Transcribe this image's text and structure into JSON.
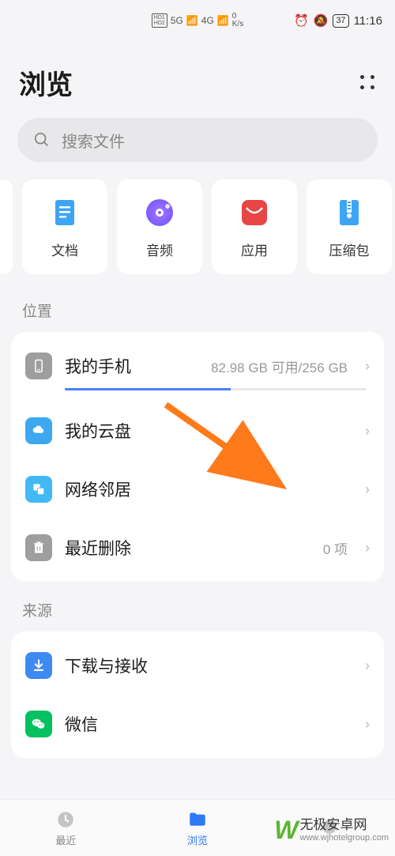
{
  "status": {
    "hd1": "HD1",
    "hd2": "HD2",
    "signal1": "5G",
    "signal2": "4G",
    "speed": "0",
    "speed_unit": "K/s",
    "battery": "37",
    "time": "11:16"
  },
  "header": {
    "title": "浏览"
  },
  "search": {
    "placeholder": "搜索文件"
  },
  "categories": [
    {
      "label": "文档",
      "icon": "document"
    },
    {
      "label": "音频",
      "icon": "audio"
    },
    {
      "label": "应用",
      "icon": "app"
    },
    {
      "label": "压缩包",
      "icon": "archive"
    }
  ],
  "sections": {
    "location": {
      "title": "位置",
      "items": [
        {
          "label": "我的手机",
          "detail": "82.98 GB 可用/256 GB",
          "icon": "phone"
        },
        {
          "label": "我的云盘",
          "icon": "cloud"
        },
        {
          "label": "网络邻居",
          "icon": "network"
        },
        {
          "label": "最近删除",
          "detail": "0 项",
          "icon": "trash"
        }
      ]
    },
    "source": {
      "title": "来源",
      "items": [
        {
          "label": "下载与接收",
          "icon": "download"
        },
        {
          "label": "微信",
          "icon": "wechat"
        }
      ]
    }
  },
  "nav": {
    "recent": "最近",
    "browse": "浏览"
  },
  "watermark": {
    "title": "无极安卓网",
    "url": "www.wjhotelgroup.com"
  }
}
